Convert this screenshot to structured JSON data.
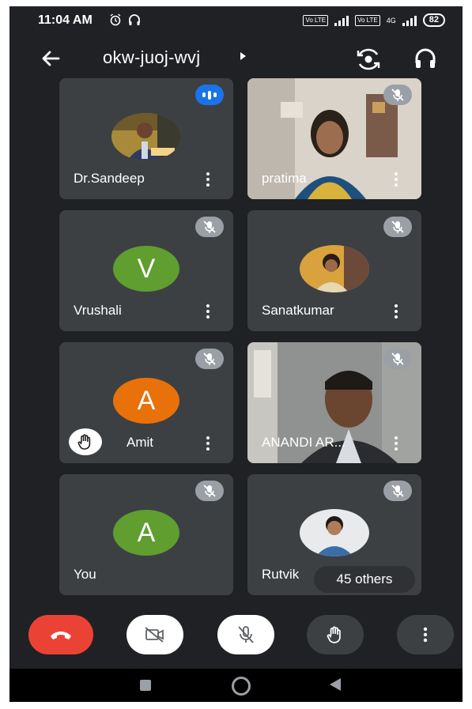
{
  "status_bar": {
    "time": "11:04 AM",
    "volte1": "Vo LTE",
    "volte2": "Vo LTE",
    "network": "4G",
    "battery": "82"
  },
  "top_bar": {
    "meeting_code": "okw-juoj-wvj"
  },
  "tiles": [
    {
      "name": "Dr.Sandeep",
      "avatar": "photo",
      "state": "speaking"
    },
    {
      "name": "pratima",
      "avatar": "video",
      "state": "muted"
    },
    {
      "name": "Vrushali",
      "avatar": "V",
      "avatar_color": "#5f9e2f",
      "state": "muted"
    },
    {
      "name": "Sanatkumar",
      "avatar": "photo",
      "state": "muted"
    },
    {
      "name": "Amit",
      "avatar": "A",
      "avatar_color": "#e8710a",
      "state": "muted",
      "hand_raised": true
    },
    {
      "name": "ANANDI AR...",
      "avatar": "video",
      "state": "muted"
    },
    {
      "name": "You",
      "avatar": "A",
      "avatar_color": "#5f9e2f",
      "state": "muted"
    },
    {
      "name": "Rutvik",
      "avatar": "photo",
      "state": "muted"
    }
  ],
  "others_label": "45 others",
  "colors": {
    "background": "#202124",
    "tile": "#3c4043",
    "end_call": "#ea4335",
    "speaking": "#1a73e8"
  },
  "icons": {
    "back": "arrow-left-icon",
    "switch_camera": "switch-camera-icon",
    "audio": "headphones-icon",
    "end_call": "phone-hangup-icon",
    "camera": "camera-off-icon",
    "mic": "mic-off-icon",
    "hand": "raise-hand-icon",
    "more": "more-vertical-icon"
  }
}
